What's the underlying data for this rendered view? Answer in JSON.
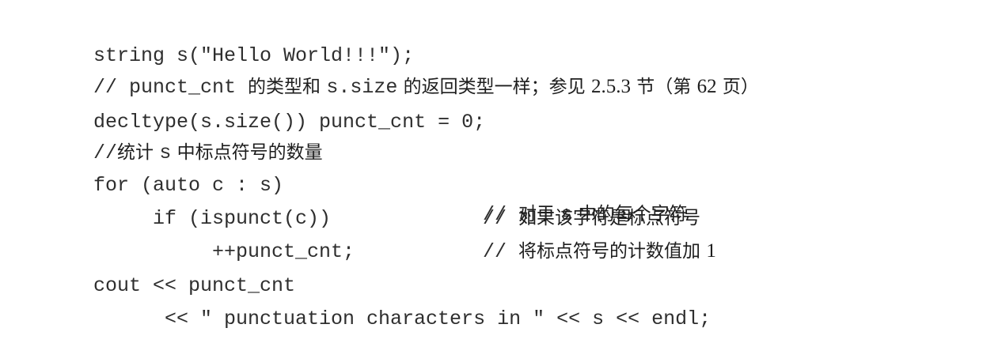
{
  "code": {
    "line1": "string s(\"Hello World!!!\");",
    "line2_a": "// punct_cnt ",
    "line2_b": "的类型和 ",
    "line2_c": "s.size",
    "line2_d": " 的返回类型一样；参见 ",
    "line2_e": "2.5.3",
    "line2_f": " 节（第 ",
    "line2_g": "62",
    "line2_h": " 页）",
    "line3": "decltype(s.size()) punct_cnt = 0;",
    "line4_a": "//",
    "line4_b": "统计 ",
    "line4_c": "s",
    "line4_d": " 中标点符号的数量",
    "line5_code": "for (auto c : s)",
    "line5_cmt_a": "// ",
    "line5_cmt_b": "对于 ",
    "line5_cmt_c": "s",
    "line5_cmt_d": " 中的每个字符",
    "line6_code": "if (ispunct(c))",
    "line6_cmt_a": "// ",
    "line6_cmt_b": "如果该字符是标点符号",
    "line7_code": "++punct_cnt;",
    "line7_cmt_a": "// ",
    "line7_cmt_b": "将标点符号的计数值加 ",
    "line7_cmt_c": "1",
    "line8": "cout << punct_cnt",
    "line9": "<< \" punctuation characters in \" << s << endl;"
  }
}
